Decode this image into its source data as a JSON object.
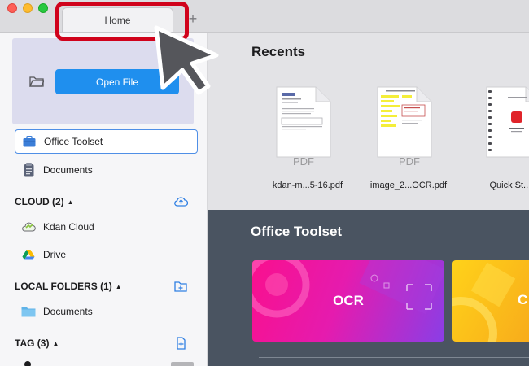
{
  "window": {
    "active_tab": "Home",
    "new_tab_label": "+"
  },
  "sidebar": {
    "open_file_label": "Open File",
    "items": [
      {
        "label": "Office Toolset",
        "icon": "briefcase-icon"
      },
      {
        "label": "Documents",
        "icon": "document-icon"
      }
    ],
    "sections": {
      "cloud": {
        "label": "CLOUD (2)",
        "caret": "▲",
        "items": [
          {
            "label": "Kdan Cloud",
            "icon": "kdan-cloud-icon"
          },
          {
            "label": "Drive",
            "icon": "google-drive-icon"
          }
        ]
      },
      "local": {
        "label": "LOCAL FOLDERS (1)",
        "caret": "▲",
        "items": [
          {
            "label": "Documents",
            "icon": "folder-icon"
          }
        ]
      },
      "tag": {
        "label": "TAG (3)",
        "caret": "▲"
      }
    }
  },
  "recents": {
    "title": "Recents",
    "files": [
      {
        "name": "kdan-m...5-16.pdf",
        "thumb_label": "PDF"
      },
      {
        "name": "image_2...OCR.pdf",
        "thumb_label": "PDF"
      },
      {
        "name": "Quick St...and",
        "thumb_label": ""
      }
    ]
  },
  "toolset": {
    "title": "Office Toolset",
    "cards": [
      {
        "label": "OCR"
      },
      {
        "label": "C"
      }
    ]
  },
  "colors": {
    "accent": "#1f8fee",
    "annotation": "#d0021b",
    "toolset_bg": "#4a5461"
  }
}
